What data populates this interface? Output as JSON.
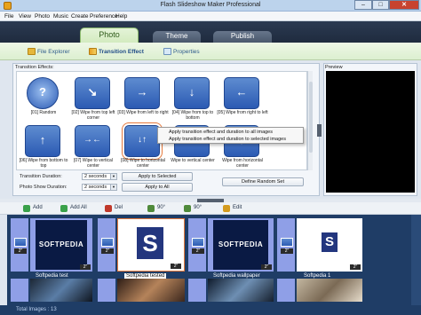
{
  "window": {
    "title": "Flash Slideshow Maker Professional",
    "minimize": "–",
    "maximize": "□",
    "close": "✕"
  },
  "menu": [
    "File",
    "View",
    "Photo",
    "Music",
    "Create",
    "Preference",
    "Help"
  ],
  "main_tabs": [
    {
      "label": "Photo",
      "active": true
    },
    {
      "label": "Theme",
      "active": false
    },
    {
      "label": "Publish",
      "active": false
    }
  ],
  "sub_tabs": [
    {
      "label": "File Explorer",
      "icon": "folder-icon",
      "active": false
    },
    {
      "label": "Transition Effect",
      "icon": "transition-icon",
      "active": true
    },
    {
      "label": "Properties",
      "icon": "properties-icon",
      "active": false
    }
  ],
  "transition_panel": {
    "label": "Transition Effects:",
    "effects": [
      {
        "caption": "[01] Random",
        "glyph": "?"
      },
      {
        "caption": "[02] Wipe from top left corner",
        "glyph": "↘"
      },
      {
        "caption": "[03] Wipe from left to right",
        "glyph": "→"
      },
      {
        "caption": "[04] Wipe from top to bottom",
        "glyph": "↓"
      },
      {
        "caption": "[05] Wipe from right to left",
        "glyph": "←"
      },
      {
        "caption": "[06] Wipe from bottom to top",
        "glyph": "↑"
      },
      {
        "caption": "[07] Wipe to vertical center",
        "glyph": "→←"
      },
      {
        "caption": "[08] Wipe to horizontal center",
        "glyph": "↓↑"
      },
      {
        "caption": "Wipe to vertical center",
        "glyph": ""
      },
      {
        "caption": "Wipe from horizontal center",
        "glyph": "↕"
      }
    ],
    "context_menu": [
      "Apply transition effect and duration to all images",
      "Apply transition effect and duration to selected images"
    ],
    "transition_duration_label": "Transition Duration:",
    "transition_duration_value": "2 seconds",
    "photo_show_duration_label": "Photo Show Duration:",
    "photo_show_duration_value": "2 seconds",
    "apply_selected": "Apply to Selected",
    "apply_all": "Apply to All",
    "define_random": "Define Random Set"
  },
  "preview": {
    "label": "Preview"
  },
  "toolbar": [
    {
      "label": "Add",
      "icon": "add-icon",
      "color": "#3aa14a"
    },
    {
      "label": "Add All",
      "icon": "add-all-icon",
      "color": "#3aa14a"
    },
    {
      "label": "Del",
      "icon": "delete-icon",
      "color": "#c0392b"
    },
    {
      "label": "90°",
      "icon": "rotate-left-icon",
      "color": "#4f8a3b"
    },
    {
      "label": "90°",
      "icon": "rotate-right-icon",
      "color": "#4f8a3b"
    },
    {
      "label": "Edit",
      "icon": "edit-icon",
      "color": "#d49b1f"
    }
  ],
  "timeline": {
    "clips": [
      {
        "caption": "Softpedia test",
        "duration": "2\"",
        "logo": "SOFTPEDIA",
        "transition_duration": "2\""
      },
      {
        "caption": "Softpedia tested",
        "duration": "2\"",
        "logo": "S",
        "transition_duration": "2\""
      },
      {
        "caption": "Softpedia wallpaper",
        "duration": "2\"",
        "logo": "SOFTPEDIA",
        "transition_duration": "2\""
      },
      {
        "caption": "Softpedia 1",
        "duration": "2\"",
        "logo": "S",
        "transition_duration": "2\""
      }
    ]
  },
  "status": {
    "text": "Total Images : 13"
  }
}
